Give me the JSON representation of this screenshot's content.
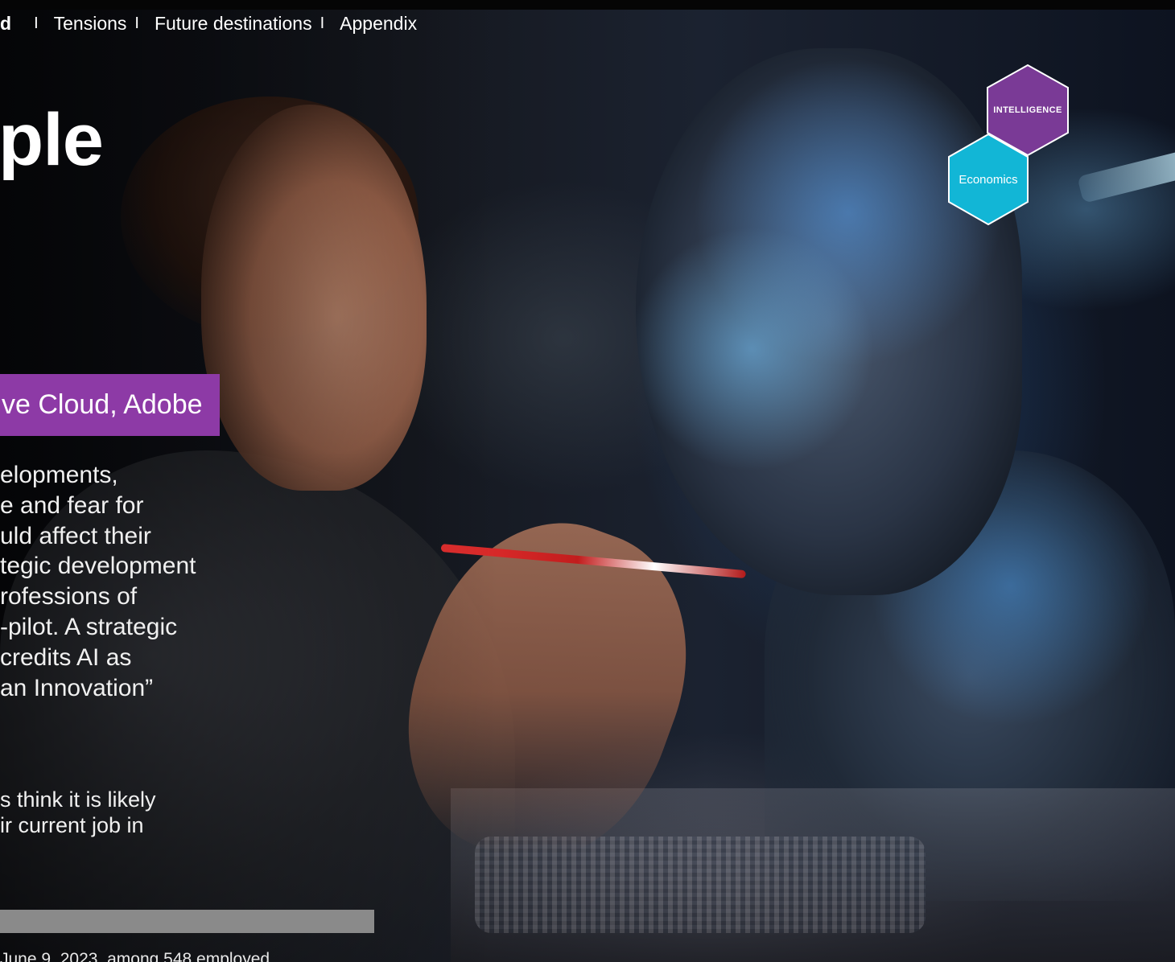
{
  "nav": {
    "items": [
      {
        "label": "d",
        "bold": true
      },
      {
        "label": "Tensions"
      },
      {
        "label": "Future destinations"
      },
      {
        "label": "Appendix"
      }
    ],
    "separator": "I"
  },
  "title": "ple",
  "banner": "ve Cloud, Adobe",
  "paragraph_lines": [
    "elopments,",
    "e and fear for",
    "uld affect their",
    "tegic development",
    "rofessions of",
    "-pilot. A strategic",
    " credits AI as",
    "an Innovation”"
  ],
  "stat_lines": [
    "s think it is likely",
    "ir current job in"
  ],
  "progress": {
    "fill_percent": 100
  },
  "source": "June 9, 2023, among 548 employed",
  "badges": {
    "intelligence": {
      "label": "INTELLIGENCE",
      "color": "#7a3a96"
    },
    "economics": {
      "label": "Economics",
      "color": "#12b6d6"
    }
  },
  "colors": {
    "banner": "#8d3aa6",
    "background": "#07080c"
  }
}
